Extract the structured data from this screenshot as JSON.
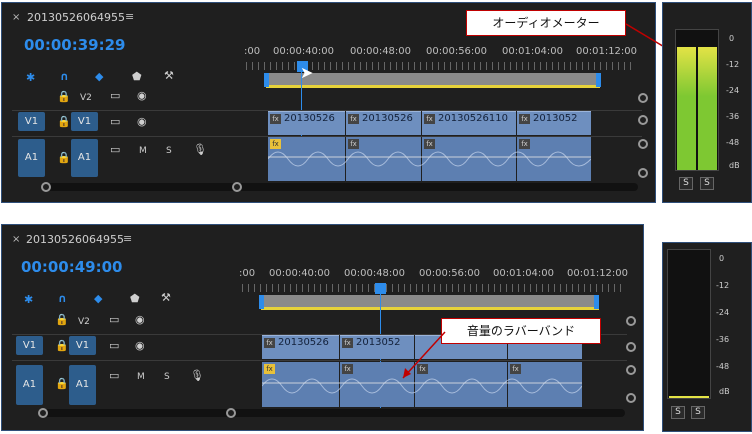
{
  "panel_top": {
    "sequence_name": "20130526064955",
    "timecode": "00:00:39:29",
    "ruler": [
      ":00",
      "00:00:40:00",
      "00:00:48:00",
      "00:00:56:00",
      "00:01:04:00",
      "00:01:12:00"
    ],
    "tracks": {
      "v2": "V2",
      "v1_src": "V1",
      "v1": "V1",
      "a1_src": "A1",
      "a1": "A1",
      "m": "M",
      "s": "S"
    },
    "clips": [
      "20130526",
      "20130526",
      "20130526110",
      "2013052"
    ],
    "callout": "オーディオメーター"
  },
  "panel_bottom": {
    "sequence_name": "20130526064955",
    "timecode": "00:00:49:00",
    "ruler": [
      ":00",
      "00:00:40:00",
      "00:00:48:00",
      "00:00:56:00",
      "00:01:04:00",
      "00:01:12:00"
    ],
    "tracks": {
      "v2": "V2",
      "v1_src": "V1",
      "v1": "V1",
      "a1_src": "A1",
      "a1": "A1",
      "m": "M",
      "s": "S"
    },
    "clips": [
      "20130526",
      "2013052"
    ],
    "callout": "音量のラバーバンド"
  },
  "meter": {
    "scale": [
      "0",
      "-12",
      "-24",
      "-36",
      "-48",
      "dB"
    ],
    "solo": "S",
    "level_top_left": 0.85,
    "level_top_right": 0.86,
    "level_bottom": 0.0
  },
  "colors": {
    "accent": "#2d8ceb",
    "panel": "#1f1f1f",
    "clip": "#6e8fbf",
    "meter_green": "#7ec832",
    "meter_yellow": "#e3e346"
  }
}
